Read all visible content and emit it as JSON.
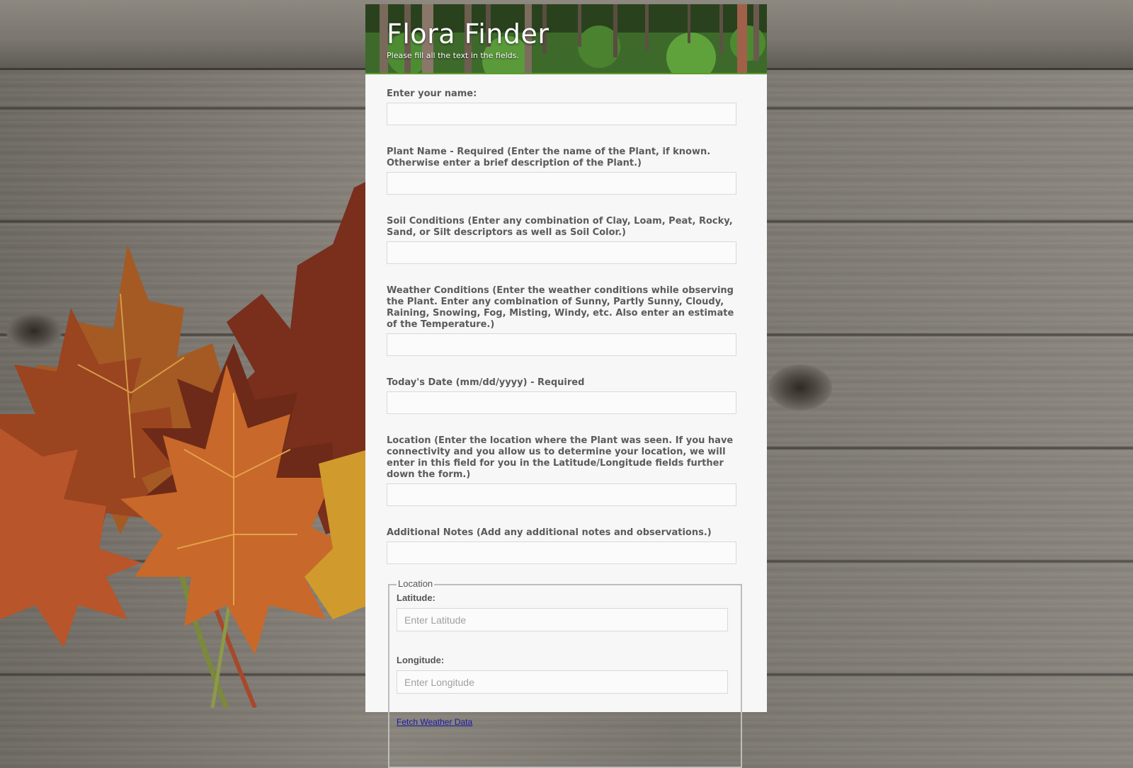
{
  "header": {
    "title": "Flora Finder",
    "subtitle": "Please fill all the text in the fields."
  },
  "fields": [
    {
      "label": "Enter your name:",
      "value": ""
    },
    {
      "label": "Plant Name - Required (Enter the name of the Plant, if known. Otherwise enter a brief description of the Plant.)",
      "value": ""
    },
    {
      "label": "Soil Conditions (Enter any combination of Clay, Loam, Peat, Rocky, Sand, or Silt descriptors as well as Soil Color.)",
      "value": ""
    },
    {
      "label": "Weather Conditions (Enter the weather conditions while observing the Plant. Enter any combination of Sunny, Partly Sunny, Cloudy, Raining, Snowing, Fog, Misting, Windy, etc. Also enter an estimate of the Temperature.)",
      "value": ""
    },
    {
      "label": "Today's Date (mm/dd/yyyy) - Required",
      "value": ""
    },
    {
      "label": "Location (Enter the location where the Plant was seen. If you have connectivity and you allow us to determine your location, we will enter in this field for you in the Latitude/Longitude fields further down the form.)",
      "value": ""
    },
    {
      "label": "Additional Notes (Add any additional notes and observations.)",
      "value": ""
    }
  ],
  "location_group": {
    "legend": "Location",
    "latitude": {
      "label": "Latitude:",
      "placeholder": "Enter Latitude",
      "value": ""
    },
    "longitude": {
      "label": "Longitude:",
      "placeholder": "Enter Longitude",
      "value": ""
    },
    "fetch_link": "Fetch Weather Data"
  },
  "colors": {
    "panel_background": "#f7f7f7",
    "label_text": "#5b5b5b",
    "link": "#1a1aa6",
    "banner_green": "#4f8a32"
  }
}
